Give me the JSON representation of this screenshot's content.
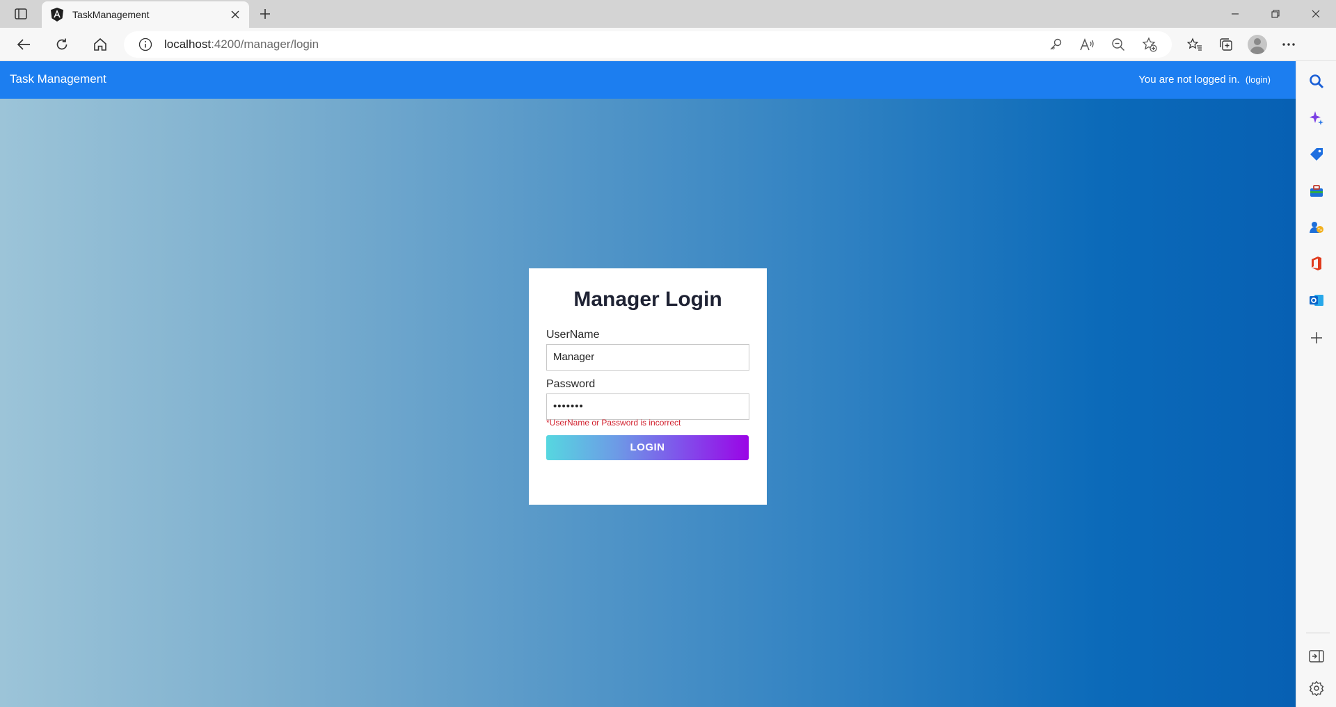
{
  "browser": {
    "tab": {
      "title": "TaskManagement",
      "favicon": "angular-icon"
    },
    "address": {
      "host": "localhost",
      "path": ":4200/manager/login"
    },
    "toolbar_icons": [
      "key-icon",
      "read-aloud-icon",
      "zoom-out-icon",
      "add-favorite-icon",
      "favorites-icon",
      "collections-icon",
      "profile-avatar-icon",
      "more-icon"
    ],
    "sidebar_icons": [
      "search-icon",
      "copilot-icon",
      "shopping-icon",
      "tools-icon",
      "games-icon",
      "office-icon",
      "outlook-icon",
      "add-icon",
      "hide-sidebar-icon",
      "settings-icon"
    ]
  },
  "app": {
    "brand": "Task Management",
    "status_text": "You are not logged in.",
    "status_link": "(login)"
  },
  "login": {
    "title": "Manager Login",
    "username_label": "UserName",
    "username_value": "Manager",
    "password_label": "Password",
    "password_value": "•••••••",
    "error": "*UserName or Password is incorrect",
    "button": "LOGIN"
  },
  "colors": {
    "header": "#1c7ef0",
    "error": "#d11f2c",
    "button_gradient_start": "#56d7e0",
    "button_gradient_end": "#9a05e6"
  }
}
